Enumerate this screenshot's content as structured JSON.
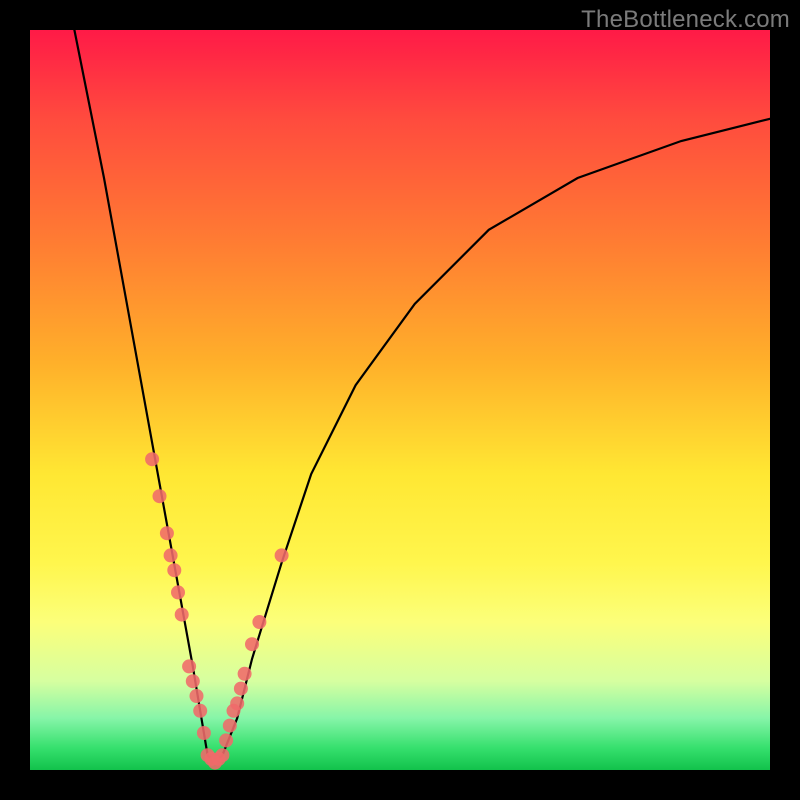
{
  "watermark": {
    "text": "TheBottleneck.com"
  },
  "chart_data": {
    "type": "line",
    "title": "",
    "xlabel": "",
    "ylabel": "",
    "xlim": [
      0,
      100
    ],
    "ylim": [
      0,
      100
    ],
    "series": [
      {
        "name": "bottleneck-curve",
        "x": [
          6,
          8,
          10,
          12,
          14,
          16,
          18,
          20,
          22,
          23,
          24,
          25,
          26,
          28,
          30,
          34,
          38,
          44,
          52,
          62,
          74,
          88,
          100
        ],
        "values": [
          100,
          90,
          80,
          69,
          58,
          47,
          36,
          25,
          14,
          8,
          2,
          1,
          2,
          7,
          15,
          28,
          40,
          52,
          63,
          73,
          80,
          85,
          88
        ]
      }
    ],
    "markers": {
      "name": "data-points",
      "color": "#f06a6a",
      "x": [
        16.5,
        17.5,
        18.5,
        19.0,
        19.5,
        20.0,
        20.5,
        21.5,
        22.0,
        22.5,
        23.0,
        23.5,
        24.0,
        24.5,
        25.0,
        25.5,
        26.0,
        26.5,
        27.0,
        27.5,
        28.0,
        28.5,
        29.0,
        30.0,
        31.0,
        34.0
      ],
      "values": [
        42,
        37,
        32,
        29,
        27,
        24,
        21,
        14,
        12,
        10,
        8,
        5,
        2,
        1.5,
        1,
        1.5,
        2,
        4,
        6,
        8,
        9,
        11,
        13,
        17,
        20,
        29
      ]
    },
    "background_gradient": {
      "top": "#ff1a47",
      "mid": "#ffe733",
      "bottom": "#12c24b"
    }
  }
}
